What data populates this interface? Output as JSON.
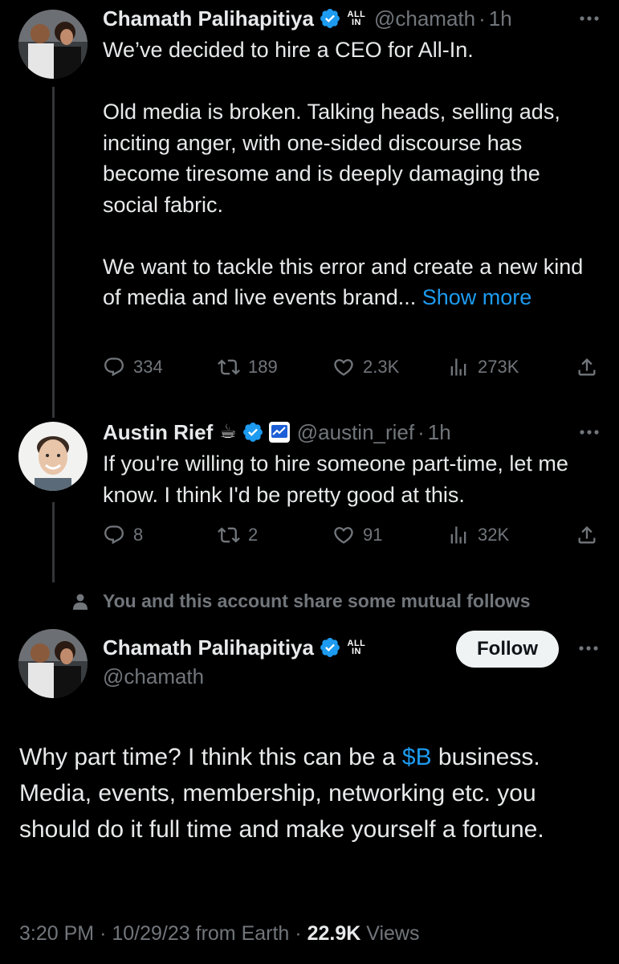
{
  "tweet1": {
    "name": "Chamath Palihapitiya",
    "badge": [
      "ALL",
      "IN"
    ],
    "handle": "@chamath",
    "sep": "·",
    "time": "1h",
    "paragraphs": [
      "We’ve decided to hire a CEO for All-In.",
      "Old media is broken. Talking heads, selling ads, inciting anger, with one-sided discourse has become tiresome and is deeply damaging the social fabric."
    ],
    "last_paragraph": "We want to tackle this error and create a new kind of media and live events brand...",
    "show_more": "Show more",
    "replies": "334",
    "retweets": "189",
    "likes": "2.3K",
    "views": "273K"
  },
  "tweet2": {
    "name": "Austin Rief",
    "emoji": "☕",
    "handle": "@austin_rief",
    "sep": "·",
    "time": "1h",
    "text": "If you're willing to hire someone part-time, let me know. I think I'd be pretty good at this.",
    "replies": "8",
    "retweets": "2",
    "likes": "91",
    "views": "32K"
  },
  "mutual": "You and this account share some mutual follows",
  "main": {
    "name": "Chamath Palihapitiya",
    "badge": [
      "ALL",
      "IN"
    ],
    "handle": "@chamath",
    "follow": "Follow",
    "text_before": "Why part time? I think this can be a ",
    "cashtag": "$B",
    "text_after": " business. Media, events, membership, networking etc. you should do it full time and make yourself a fortune.",
    "time": "3:20 PM",
    "date": "10/29/23",
    "source": "from Earth",
    "views_count": "22.9K",
    "views_label": "Views",
    "sep": "·"
  },
  "colors": {
    "background": "#000000",
    "text": "#e7e9ea",
    "secondary": "#71767b",
    "link": "#1d9bf0",
    "verified": "#1d9bf0"
  },
  "icons": [
    "more-icon",
    "verified-icon",
    "reply-icon",
    "retweet-icon",
    "like-icon",
    "views-icon",
    "share-icon",
    "person-icon"
  ]
}
